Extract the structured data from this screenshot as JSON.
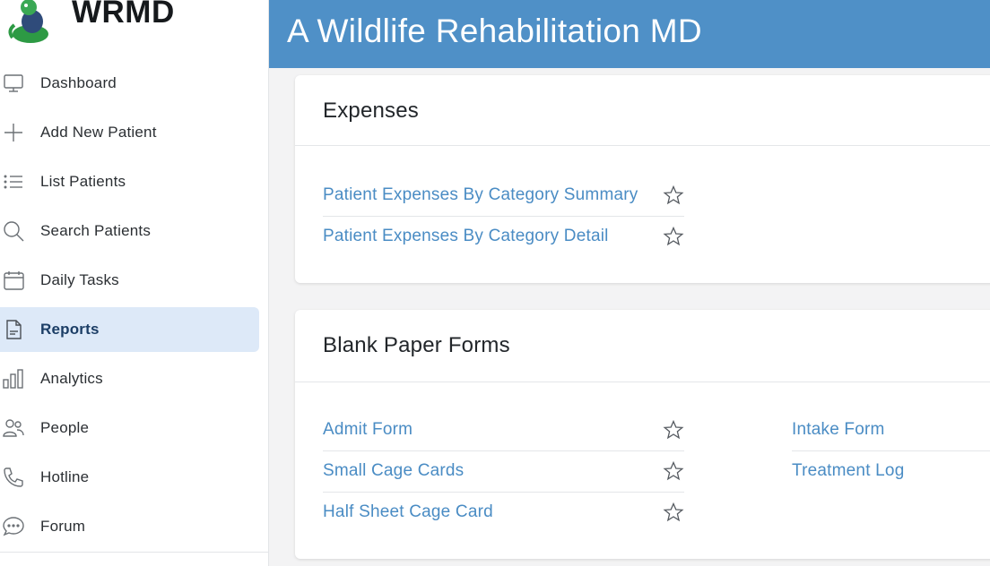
{
  "brand": {
    "name": "WRMD"
  },
  "header": {
    "title": "A Wildlife Rehabilitation MD"
  },
  "sidebar": {
    "items": [
      {
        "label": "Dashboard",
        "icon": "monitor-icon"
      },
      {
        "label": "Add New Patient",
        "icon": "plus-icon"
      },
      {
        "label": "List Patients",
        "icon": "list-icon"
      },
      {
        "label": "Search Patients",
        "icon": "search-icon"
      },
      {
        "label": "Daily Tasks",
        "icon": "calendar-icon"
      },
      {
        "label": "Reports",
        "icon": "document-icon",
        "active": true
      },
      {
        "label": "Analytics",
        "icon": "bar-chart-icon"
      },
      {
        "label": "People",
        "icon": "people-icon"
      },
      {
        "label": "Hotline",
        "icon": "phone-icon"
      },
      {
        "label": "Forum",
        "icon": "chat-bubble-icon"
      }
    ]
  },
  "expenses": {
    "title": "Expenses",
    "links": [
      {
        "label": "Patient Expenses By Category Summary"
      },
      {
        "label": "Patient Expenses By Category Detail"
      }
    ]
  },
  "forms": {
    "title": "Blank Paper Forms",
    "left_links": [
      {
        "label": "Admit Form"
      },
      {
        "label": "Small Cage Cards"
      },
      {
        "label": "Half Sheet Cage Card"
      }
    ],
    "right_links": [
      {
        "label": "Intake Form"
      },
      {
        "label": "Treatment Log"
      }
    ]
  },
  "colors": {
    "header_bg": "#4f90c7",
    "link": "#4a8cc4",
    "active_nav_bg": "#dde9f8"
  }
}
